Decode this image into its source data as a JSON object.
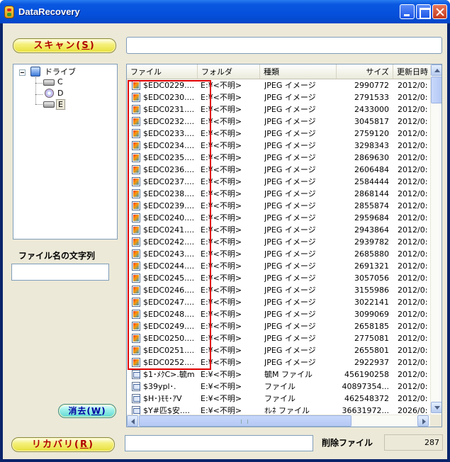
{
  "window": {
    "title": "DataRecovery"
  },
  "buttons": {
    "scan": {
      "main": "スキャン(",
      "key": "S",
      "tail": ")"
    },
    "recover": {
      "main": "リカバリ(",
      "key": "R",
      "tail": ")"
    },
    "clear": {
      "main": "消去(",
      "key": "W",
      "tail": ")"
    }
  },
  "tree": {
    "root": "ドライブ",
    "drives": [
      "C",
      "D",
      "E"
    ],
    "selected": "E"
  },
  "filename_filter": {
    "label": "ファイル名の文字列",
    "value": ""
  },
  "file_list": {
    "columns": [
      "ファイル",
      "フォルダ",
      "種類",
      "サイズ",
      "更新日時"
    ],
    "rows": [
      {
        "name": "$EDC0229....",
        "folder": "E:¥<不明>",
        "type": "JPEG イメージ",
        "size": "2990772",
        "date": "2012/0:",
        "icon": "jpeg"
      },
      {
        "name": "$EDC0230....",
        "folder": "E:¥<不明>",
        "type": "JPEG イメージ",
        "size": "2791533",
        "date": "2012/0:",
        "icon": "jpeg"
      },
      {
        "name": "$EDC0231....",
        "folder": "E:¥<不明>",
        "type": "JPEG イメージ",
        "size": "2433000",
        "date": "2012/0:",
        "icon": "jpeg"
      },
      {
        "name": "$EDC0232....",
        "folder": "E:¥<不明>",
        "type": "JPEG イメージ",
        "size": "3045817",
        "date": "2012/0:",
        "icon": "jpeg"
      },
      {
        "name": "$EDC0233....",
        "folder": "E:¥<不明>",
        "type": "JPEG イメージ",
        "size": "2759120",
        "date": "2012/0:",
        "icon": "jpeg"
      },
      {
        "name": "$EDC0234....",
        "folder": "E:¥<不明>",
        "type": "JPEG イメージ",
        "size": "3298343",
        "date": "2012/0:",
        "icon": "jpeg"
      },
      {
        "name": "$EDC0235....",
        "folder": "E:¥<不明>",
        "type": "JPEG イメージ",
        "size": "2869630",
        "date": "2012/0:",
        "icon": "jpeg"
      },
      {
        "name": "$EDC0236....",
        "folder": "E:¥<不明>",
        "type": "JPEG イメージ",
        "size": "2606484",
        "date": "2012/0:",
        "icon": "jpeg"
      },
      {
        "name": "$EDC0237....",
        "folder": "E:¥<不明>",
        "type": "JPEG イメージ",
        "size": "2584444",
        "date": "2012/0:",
        "icon": "jpeg"
      },
      {
        "name": "$EDC0238....",
        "folder": "E:¥<不明>",
        "type": "JPEG イメージ",
        "size": "2868144",
        "date": "2012/0:",
        "icon": "jpeg"
      },
      {
        "name": "$EDC0239....",
        "folder": "E:¥<不明>",
        "type": "JPEG イメージ",
        "size": "2855874",
        "date": "2012/0:",
        "icon": "jpeg"
      },
      {
        "name": "$EDC0240....",
        "folder": "E:¥<不明>",
        "type": "JPEG イメージ",
        "size": "2959684",
        "date": "2012/0:",
        "icon": "jpeg"
      },
      {
        "name": "$EDC0241....",
        "folder": "E:¥<不明>",
        "type": "JPEG イメージ",
        "size": "2943864",
        "date": "2012/0:",
        "icon": "jpeg"
      },
      {
        "name": "$EDC0242....",
        "folder": "E:¥<不明>",
        "type": "JPEG イメージ",
        "size": "2939782",
        "date": "2012/0:",
        "icon": "jpeg"
      },
      {
        "name": "$EDC0243....",
        "folder": "E:¥<不明>",
        "type": "JPEG イメージ",
        "size": "2685880",
        "date": "2012/0:",
        "icon": "jpeg"
      },
      {
        "name": "$EDC0244....",
        "folder": "E:¥<不明>",
        "type": "JPEG イメージ",
        "size": "2691321",
        "date": "2012/0:",
        "icon": "jpeg"
      },
      {
        "name": "$EDC0245....",
        "folder": "E:¥<不明>",
        "type": "JPEG イメージ",
        "size": "3057056",
        "date": "2012/0:",
        "icon": "jpeg"
      },
      {
        "name": "$EDC0246....",
        "folder": "E:¥<不明>",
        "type": "JPEG イメージ",
        "size": "3155986",
        "date": "2012/0:",
        "icon": "jpeg"
      },
      {
        "name": "$EDC0247....",
        "folder": "E:¥<不明>",
        "type": "JPEG イメージ",
        "size": "3022141",
        "date": "2012/0:",
        "icon": "jpeg"
      },
      {
        "name": "$EDC0248....",
        "folder": "E:¥<不明>",
        "type": "JPEG イメージ",
        "size": "3099069",
        "date": "2012/0:",
        "icon": "jpeg"
      },
      {
        "name": "$EDC0249....",
        "folder": "E:¥<不明>",
        "type": "JPEG イメージ",
        "size": "2658185",
        "date": "2012/0:",
        "icon": "jpeg"
      },
      {
        "name": "$EDC0250....",
        "folder": "E:¥<不明>",
        "type": "JPEG イメージ",
        "size": "2775081",
        "date": "2012/0:",
        "icon": "jpeg"
      },
      {
        "name": "$EDC0251....",
        "folder": "E:¥<不明>",
        "type": "JPEG イメージ",
        "size": "2655801",
        "date": "2012/0:",
        "icon": "jpeg"
      },
      {
        "name": "$EDC0252....",
        "folder": "E:¥<不明>",
        "type": "JPEG イメージ",
        "size": "2922937",
        "date": "2012/0:",
        "icon": "jpeg"
      },
      {
        "name": "$1･ﾒｸC>.毓m",
        "folder": "E:¥<不明>",
        "type": "毓M ファイル",
        "size": "456190258",
        "date": "2012/0:",
        "icon": "gen"
      },
      {
        "name": "$39ypl･.",
        "folder": "E:¥<不明>",
        "type": "ファイル",
        "size": "40897354...",
        "date": "2012/0:",
        "icon": "gen"
      },
      {
        "name": "$H･)ﾓﾓ･ｱV",
        "folder": "E:¥<不明>",
        "type": "ファイル",
        "size": "462548372",
        "date": "2012/0:",
        "icon": "gen"
      },
      {
        "name": "$Y#匹$安....",
        "folder": "E:¥<不明>",
        "type": "ｵﾚﾈ ファイル",
        "size": "36631972...",
        "date": "2026/0:",
        "icon": "gen"
      }
    ]
  },
  "status": {
    "deleted_files_label": "削除ファイル",
    "deleted_files_count": "287",
    "path_value": ""
  },
  "colors": {
    "titlebar": "#0550dc",
    "client": "#ece9d8",
    "highlight": "#e00000",
    "button_yellow": "#f5f07a",
    "button_cyan": "#9ef0ea"
  }
}
